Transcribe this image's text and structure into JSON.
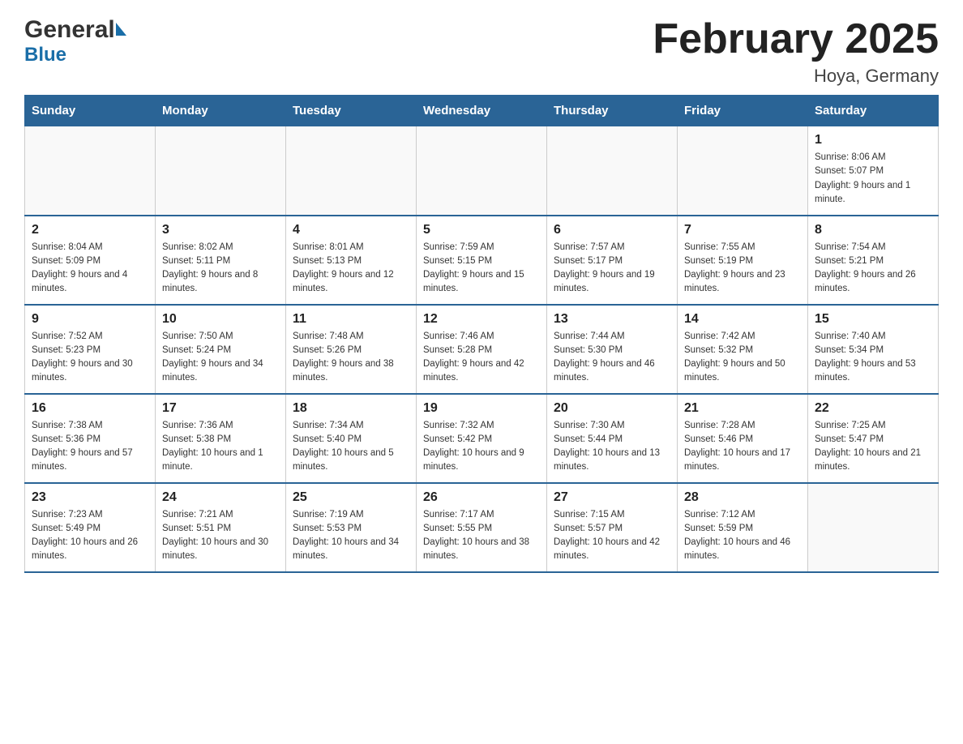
{
  "header": {
    "month_year": "February 2025",
    "location": "Hoya, Germany",
    "logo_name": "General",
    "logo_name2": "Blue"
  },
  "days_of_week": [
    "Sunday",
    "Monday",
    "Tuesday",
    "Wednesday",
    "Thursday",
    "Friday",
    "Saturday"
  ],
  "weeks": [
    [
      {
        "day": "",
        "info": ""
      },
      {
        "day": "",
        "info": ""
      },
      {
        "day": "",
        "info": ""
      },
      {
        "day": "",
        "info": ""
      },
      {
        "day": "",
        "info": ""
      },
      {
        "day": "",
        "info": ""
      },
      {
        "day": "1",
        "info": "Sunrise: 8:06 AM\nSunset: 5:07 PM\nDaylight: 9 hours and 1 minute."
      }
    ],
    [
      {
        "day": "2",
        "info": "Sunrise: 8:04 AM\nSunset: 5:09 PM\nDaylight: 9 hours and 4 minutes."
      },
      {
        "day": "3",
        "info": "Sunrise: 8:02 AM\nSunset: 5:11 PM\nDaylight: 9 hours and 8 minutes."
      },
      {
        "day": "4",
        "info": "Sunrise: 8:01 AM\nSunset: 5:13 PM\nDaylight: 9 hours and 12 minutes."
      },
      {
        "day": "5",
        "info": "Sunrise: 7:59 AM\nSunset: 5:15 PM\nDaylight: 9 hours and 15 minutes."
      },
      {
        "day": "6",
        "info": "Sunrise: 7:57 AM\nSunset: 5:17 PM\nDaylight: 9 hours and 19 minutes."
      },
      {
        "day": "7",
        "info": "Sunrise: 7:55 AM\nSunset: 5:19 PM\nDaylight: 9 hours and 23 minutes."
      },
      {
        "day": "8",
        "info": "Sunrise: 7:54 AM\nSunset: 5:21 PM\nDaylight: 9 hours and 26 minutes."
      }
    ],
    [
      {
        "day": "9",
        "info": "Sunrise: 7:52 AM\nSunset: 5:23 PM\nDaylight: 9 hours and 30 minutes."
      },
      {
        "day": "10",
        "info": "Sunrise: 7:50 AM\nSunset: 5:24 PM\nDaylight: 9 hours and 34 minutes."
      },
      {
        "day": "11",
        "info": "Sunrise: 7:48 AM\nSunset: 5:26 PM\nDaylight: 9 hours and 38 minutes."
      },
      {
        "day": "12",
        "info": "Sunrise: 7:46 AM\nSunset: 5:28 PM\nDaylight: 9 hours and 42 minutes."
      },
      {
        "day": "13",
        "info": "Sunrise: 7:44 AM\nSunset: 5:30 PM\nDaylight: 9 hours and 46 minutes."
      },
      {
        "day": "14",
        "info": "Sunrise: 7:42 AM\nSunset: 5:32 PM\nDaylight: 9 hours and 50 minutes."
      },
      {
        "day": "15",
        "info": "Sunrise: 7:40 AM\nSunset: 5:34 PM\nDaylight: 9 hours and 53 minutes."
      }
    ],
    [
      {
        "day": "16",
        "info": "Sunrise: 7:38 AM\nSunset: 5:36 PM\nDaylight: 9 hours and 57 minutes."
      },
      {
        "day": "17",
        "info": "Sunrise: 7:36 AM\nSunset: 5:38 PM\nDaylight: 10 hours and 1 minute."
      },
      {
        "day": "18",
        "info": "Sunrise: 7:34 AM\nSunset: 5:40 PM\nDaylight: 10 hours and 5 minutes."
      },
      {
        "day": "19",
        "info": "Sunrise: 7:32 AM\nSunset: 5:42 PM\nDaylight: 10 hours and 9 minutes."
      },
      {
        "day": "20",
        "info": "Sunrise: 7:30 AM\nSunset: 5:44 PM\nDaylight: 10 hours and 13 minutes."
      },
      {
        "day": "21",
        "info": "Sunrise: 7:28 AM\nSunset: 5:46 PM\nDaylight: 10 hours and 17 minutes."
      },
      {
        "day": "22",
        "info": "Sunrise: 7:25 AM\nSunset: 5:47 PM\nDaylight: 10 hours and 21 minutes."
      }
    ],
    [
      {
        "day": "23",
        "info": "Sunrise: 7:23 AM\nSunset: 5:49 PM\nDaylight: 10 hours and 26 minutes."
      },
      {
        "day": "24",
        "info": "Sunrise: 7:21 AM\nSunset: 5:51 PM\nDaylight: 10 hours and 30 minutes."
      },
      {
        "day": "25",
        "info": "Sunrise: 7:19 AM\nSunset: 5:53 PM\nDaylight: 10 hours and 34 minutes."
      },
      {
        "day": "26",
        "info": "Sunrise: 7:17 AM\nSunset: 5:55 PM\nDaylight: 10 hours and 38 minutes."
      },
      {
        "day": "27",
        "info": "Sunrise: 7:15 AM\nSunset: 5:57 PM\nDaylight: 10 hours and 42 minutes."
      },
      {
        "day": "28",
        "info": "Sunrise: 7:12 AM\nSunset: 5:59 PM\nDaylight: 10 hours and 46 minutes."
      },
      {
        "day": "",
        "info": ""
      }
    ]
  ]
}
